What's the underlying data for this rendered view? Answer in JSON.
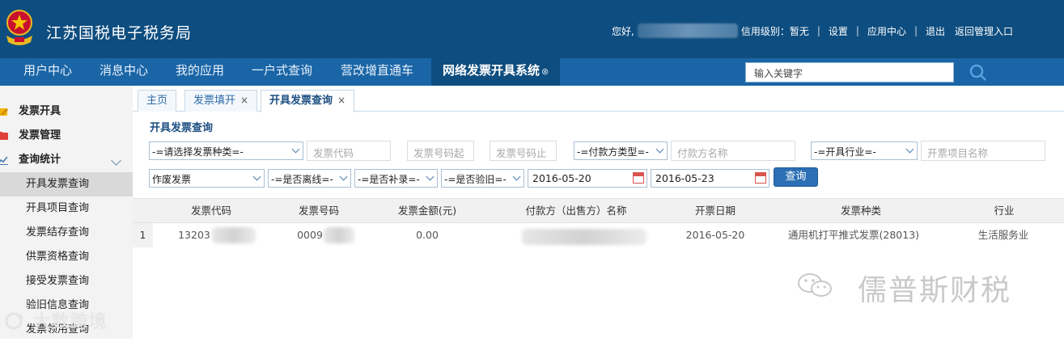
{
  "header": {
    "title": "江苏国税电子税务局",
    "greeting": "您好,",
    "credit_label": "信用级别：暂无",
    "links": [
      "设置",
      "应用中心",
      "退出",
      "返回管理入口"
    ],
    "separator": "|"
  },
  "nav": {
    "items": [
      "用户中心",
      "消息中心",
      "我的应用",
      "一户式查询",
      "营改增直通车"
    ],
    "active": "网络发票开具系统",
    "active_close": "⊗",
    "search_placeholder": "输入关键字"
  },
  "sidebar": {
    "groups": [
      "发票开具",
      "发票管理",
      "查询统计"
    ],
    "items": [
      "开具发票查询",
      "开具项目查询",
      "发票结存查询",
      "供票资格查询",
      "接受发票查询",
      "验旧信息查询",
      "发票领用查询"
    ],
    "selected": "开具发票查询"
  },
  "tabs": [
    {
      "label": "主页",
      "closable": false
    },
    {
      "label": "发票填开",
      "closable": true
    },
    {
      "label": "开具发票查询",
      "closable": true,
      "active": true
    }
  ],
  "tab_close": "×",
  "form": {
    "title": "开具发票查询",
    "invoice_type_select": "-=请选择发票种类=-",
    "invoice_code_placeholder": "发票代码",
    "invoice_no_start_placeholder": "发票号码起",
    "invoice_no_end_placeholder": "发票号码止",
    "payer_type_select": "-=付款方类型=-",
    "payer_name_placeholder": "付款方名称",
    "industry_select": "-=开具行业=-",
    "item_name_placeholder": "开票项目名称",
    "status_select": "作废发票",
    "offline_select": "-=是否离线=-",
    "supplement_select": "-=是否补录=-",
    "verified_select": "-=是否验旧=-",
    "date_from": "2016-05-20",
    "date_to": "2016-05-23",
    "query_button": "查询"
  },
  "table": {
    "columns": [
      "发票代码",
      "发票号码",
      "发票金额(元)",
      "付款方（出售方）名称",
      "开票日期",
      "发票种类",
      "行业"
    ],
    "rows": [
      {
        "index": "1",
        "code": "13203",
        "number": "0009",
        "amount": "0.00",
        "payer": "",
        "date": "2016-05-20",
        "kind": "通用机打平推式发票(28013)",
        "industry": "生活服务业"
      }
    ]
  },
  "watermarks": {
    "right": "儒普斯财税",
    "left": "大数跨境"
  },
  "colors": {
    "header_bg": "#0e4d7f",
    "nav_bg": "#1a65a6",
    "accent": "#2c6fb4"
  }
}
